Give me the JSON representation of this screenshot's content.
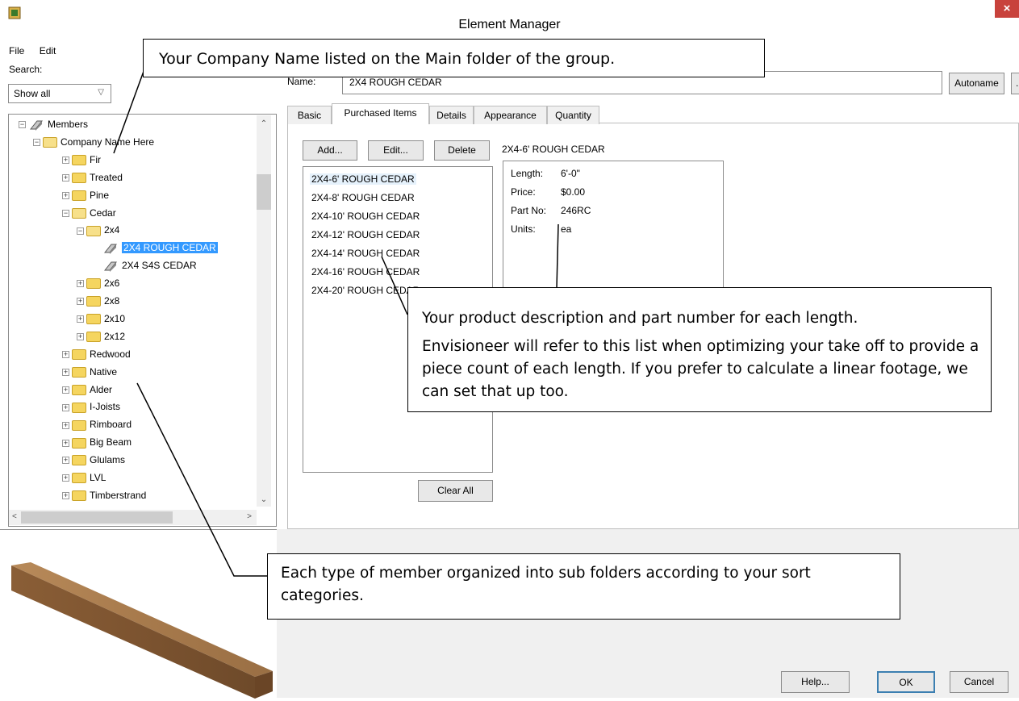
{
  "window": {
    "title": "Element Manager",
    "close_glyph": "×",
    "icon": "app-icon"
  },
  "menu": [
    "File",
    "Edit"
  ],
  "search": {
    "label": "Search:",
    "value": "Show all"
  },
  "tree": {
    "items": [
      {
        "label": "Members",
        "depth": 0,
        "icon": "member",
        "expander": "−"
      },
      {
        "label": "Company Name Here",
        "depth": 1,
        "icon": "folder-open",
        "expander": "−"
      },
      {
        "label": "Fir",
        "depth": 2,
        "icon": "folder",
        "expander": "+"
      },
      {
        "label": "Treated",
        "depth": 2,
        "icon": "folder",
        "expander": "+"
      },
      {
        "label": "Pine",
        "depth": 2,
        "icon": "folder",
        "expander": "+"
      },
      {
        "label": "Cedar",
        "depth": 2,
        "icon": "folder-open",
        "expander": "−"
      },
      {
        "label": "2x4",
        "depth": 3,
        "icon": "folder-open",
        "expander": "−"
      },
      {
        "label": "2X4 ROUGH CEDAR",
        "depth": 4,
        "icon": "member",
        "expander": "",
        "selected": true
      },
      {
        "label": "2X4 S4S CEDAR",
        "depth": 4,
        "icon": "member",
        "expander": ""
      },
      {
        "label": "2x6",
        "depth": 3,
        "icon": "folder",
        "expander": "+"
      },
      {
        "label": "2x8",
        "depth": 3,
        "icon": "folder",
        "expander": "+"
      },
      {
        "label": "2x10",
        "depth": 3,
        "icon": "folder",
        "expander": "+"
      },
      {
        "label": "2x12",
        "depth": 3,
        "icon": "folder",
        "expander": "+"
      },
      {
        "label": "Redwood",
        "depth": 2,
        "icon": "folder",
        "expander": "+"
      },
      {
        "label": "Native",
        "depth": 2,
        "icon": "folder",
        "expander": "+"
      },
      {
        "label": "Alder",
        "depth": 2,
        "icon": "folder",
        "expander": "+"
      },
      {
        "label": "I-Joists",
        "depth": 2,
        "icon": "folder",
        "expander": "+"
      },
      {
        "label": "Rimboard",
        "depth": 2,
        "icon": "folder",
        "expander": "+"
      },
      {
        "label": "Big Beam",
        "depth": 2,
        "icon": "folder",
        "expander": "+"
      },
      {
        "label": "Glulams",
        "depth": 2,
        "icon": "folder",
        "expander": "+"
      },
      {
        "label": "LVL",
        "depth": 2,
        "icon": "folder",
        "expander": "+"
      },
      {
        "label": "Timberstrand",
        "depth": 2,
        "icon": "folder",
        "expander": "+"
      }
    ]
  },
  "name_field": {
    "label": "Name:",
    "value": "2X4 ROUGH CEDAR"
  },
  "buttons": {
    "autoname": "Autoname",
    "browse": "...",
    "add": "Add...",
    "edit": "Edit...",
    "delete": "Delete",
    "clear_all": "Clear All",
    "help": "Help...",
    "ok": "OK",
    "cancel": "Cancel"
  },
  "tabs": [
    "Basic",
    "Purchased Items",
    "Details",
    "Appearance",
    "Quantity"
  ],
  "purchased_items": [
    "2X4-6' ROUGH CEDAR",
    "2X4-8' ROUGH CEDAR",
    "2X4-10' ROUGH CEDAR",
    "2X4-12' ROUGH CEDAR",
    "2X4-14' ROUGH CEDAR",
    "2X4-16' ROUGH CEDAR",
    "2X4-20' ROUGH CEDAR"
  ],
  "details": {
    "title": "2X4-6' ROUGH CEDAR",
    "rows": [
      {
        "label": "Length:",
        "value": "6'-0\""
      },
      {
        "label": "Price:",
        "value": "$0.00"
      },
      {
        "label": "Part No:",
        "value": "246RC"
      },
      {
        "label": "Units:",
        "value": "ea"
      }
    ]
  },
  "callouts": {
    "company": "Your Company Name listed on the Main folder of the group.",
    "product_1": "Your product description and part number for each length.",
    "product_2": "Envisioneer will refer to this list when optimizing your take off to provide a piece count of each length.  If you prefer to calculate a linear footage, we can set that up too.",
    "folders": "Each type of member organized into sub folders according to your sort categories."
  }
}
